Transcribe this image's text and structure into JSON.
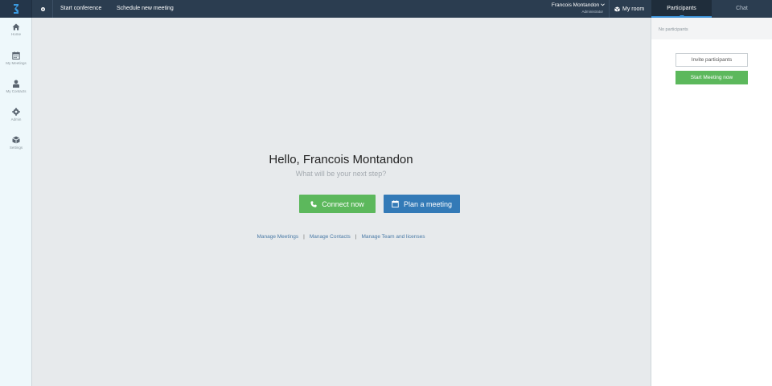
{
  "topbar": {
    "start_conference": "Start conference",
    "schedule_meeting": "Schedule new meeting",
    "user_name": "Francois Montandon",
    "user_role": "Administrator",
    "my_room": "My room"
  },
  "tabs": {
    "participants": "Participants",
    "chat": "Chat"
  },
  "sidebar": {
    "items": [
      {
        "label": "Home",
        "icon": "home-icon"
      },
      {
        "label": "My Meetings",
        "icon": "calendar-icon"
      },
      {
        "label": "My Contacts",
        "icon": "user-icon"
      },
      {
        "label": "Admin",
        "icon": "gear-icon"
      },
      {
        "label": "Settings",
        "icon": "box-icon"
      }
    ]
  },
  "main": {
    "greeting": "Hello, Francois Montandon",
    "subtitle": "What will be your next step?",
    "connect_label": "Connect now",
    "plan_label": "Plan a meeting",
    "links": {
      "manage_meetings": "Manage Meetings",
      "manage_contacts": "Manage Contacts",
      "manage_team": "Manage Team and licenses",
      "separator": "|"
    }
  },
  "participants_panel": {
    "empty_text": "No participants",
    "invite_label": "Invite participants",
    "start_label": "Start Meeting now"
  },
  "colors": {
    "topbar": "#2b3d50",
    "green": "#5cb85c",
    "blue": "#337ab7",
    "accent": "#3a8fd4"
  }
}
